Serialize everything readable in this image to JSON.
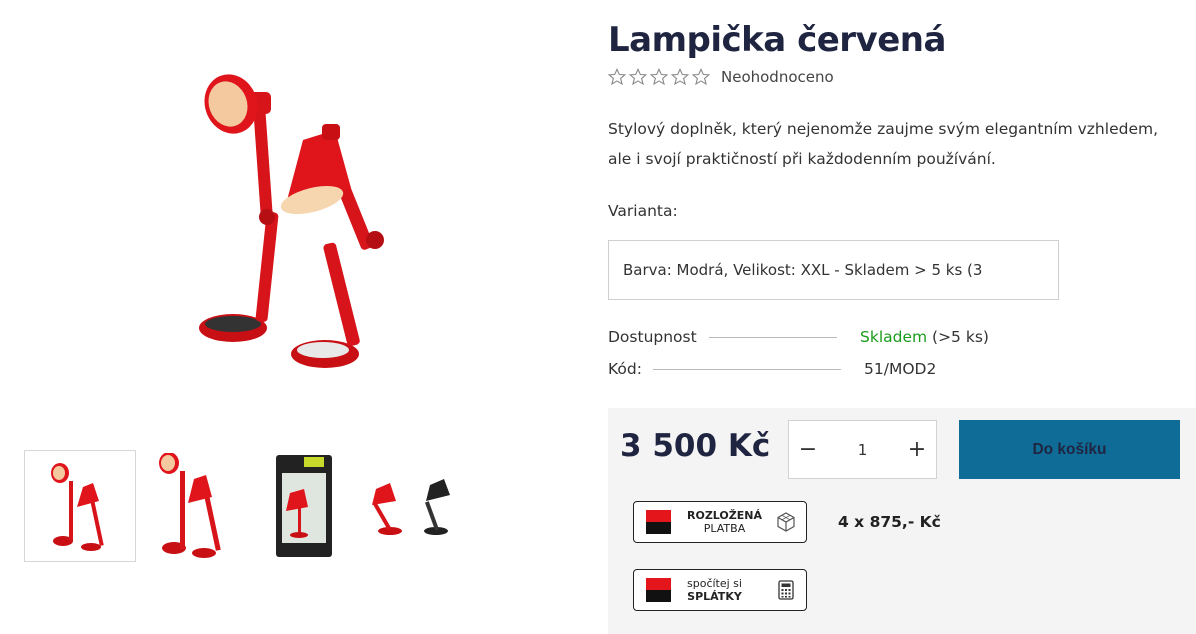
{
  "product": {
    "title": "Lampička červená",
    "rating_text": "Neohodnoceno",
    "rating_stars": 0,
    "rating_max": 5,
    "description_line1": "Stylový doplněk, který nejenomže zaujme svým elegantním vzhledem,",
    "description_line2": "ale i svojí praktičností při každodenním používání.",
    "variant_label": "Varianta:",
    "variant_value": "Barva: Modrá, Velikost: XXL - Skladem > 5 ks  (3",
    "availability_label": "Dostupnost",
    "availability_status": "Skladem",
    "availability_qty": " (>5 ks)",
    "code_label": "Kód:",
    "code_value": "51/MOD2"
  },
  "buy": {
    "price": "3 500 Kč",
    "quantity": "1",
    "minus": "−",
    "plus": "+",
    "add_to_cart": "Do košíku"
  },
  "financing": {
    "badge1_line1": "ROZLOŽENÁ",
    "badge1_line2": "PLATBA",
    "installment": "4 x 875,- Kč",
    "badge2_line1": "spočítej si",
    "badge2_line2": "SPLÁTKY"
  },
  "colors": {
    "accent": "#0e6c97",
    "title": "#1f2540",
    "in_stock": "#1a9c1a",
    "lamp_red": "#e0141b",
    "bank_red": "#e4151b"
  }
}
